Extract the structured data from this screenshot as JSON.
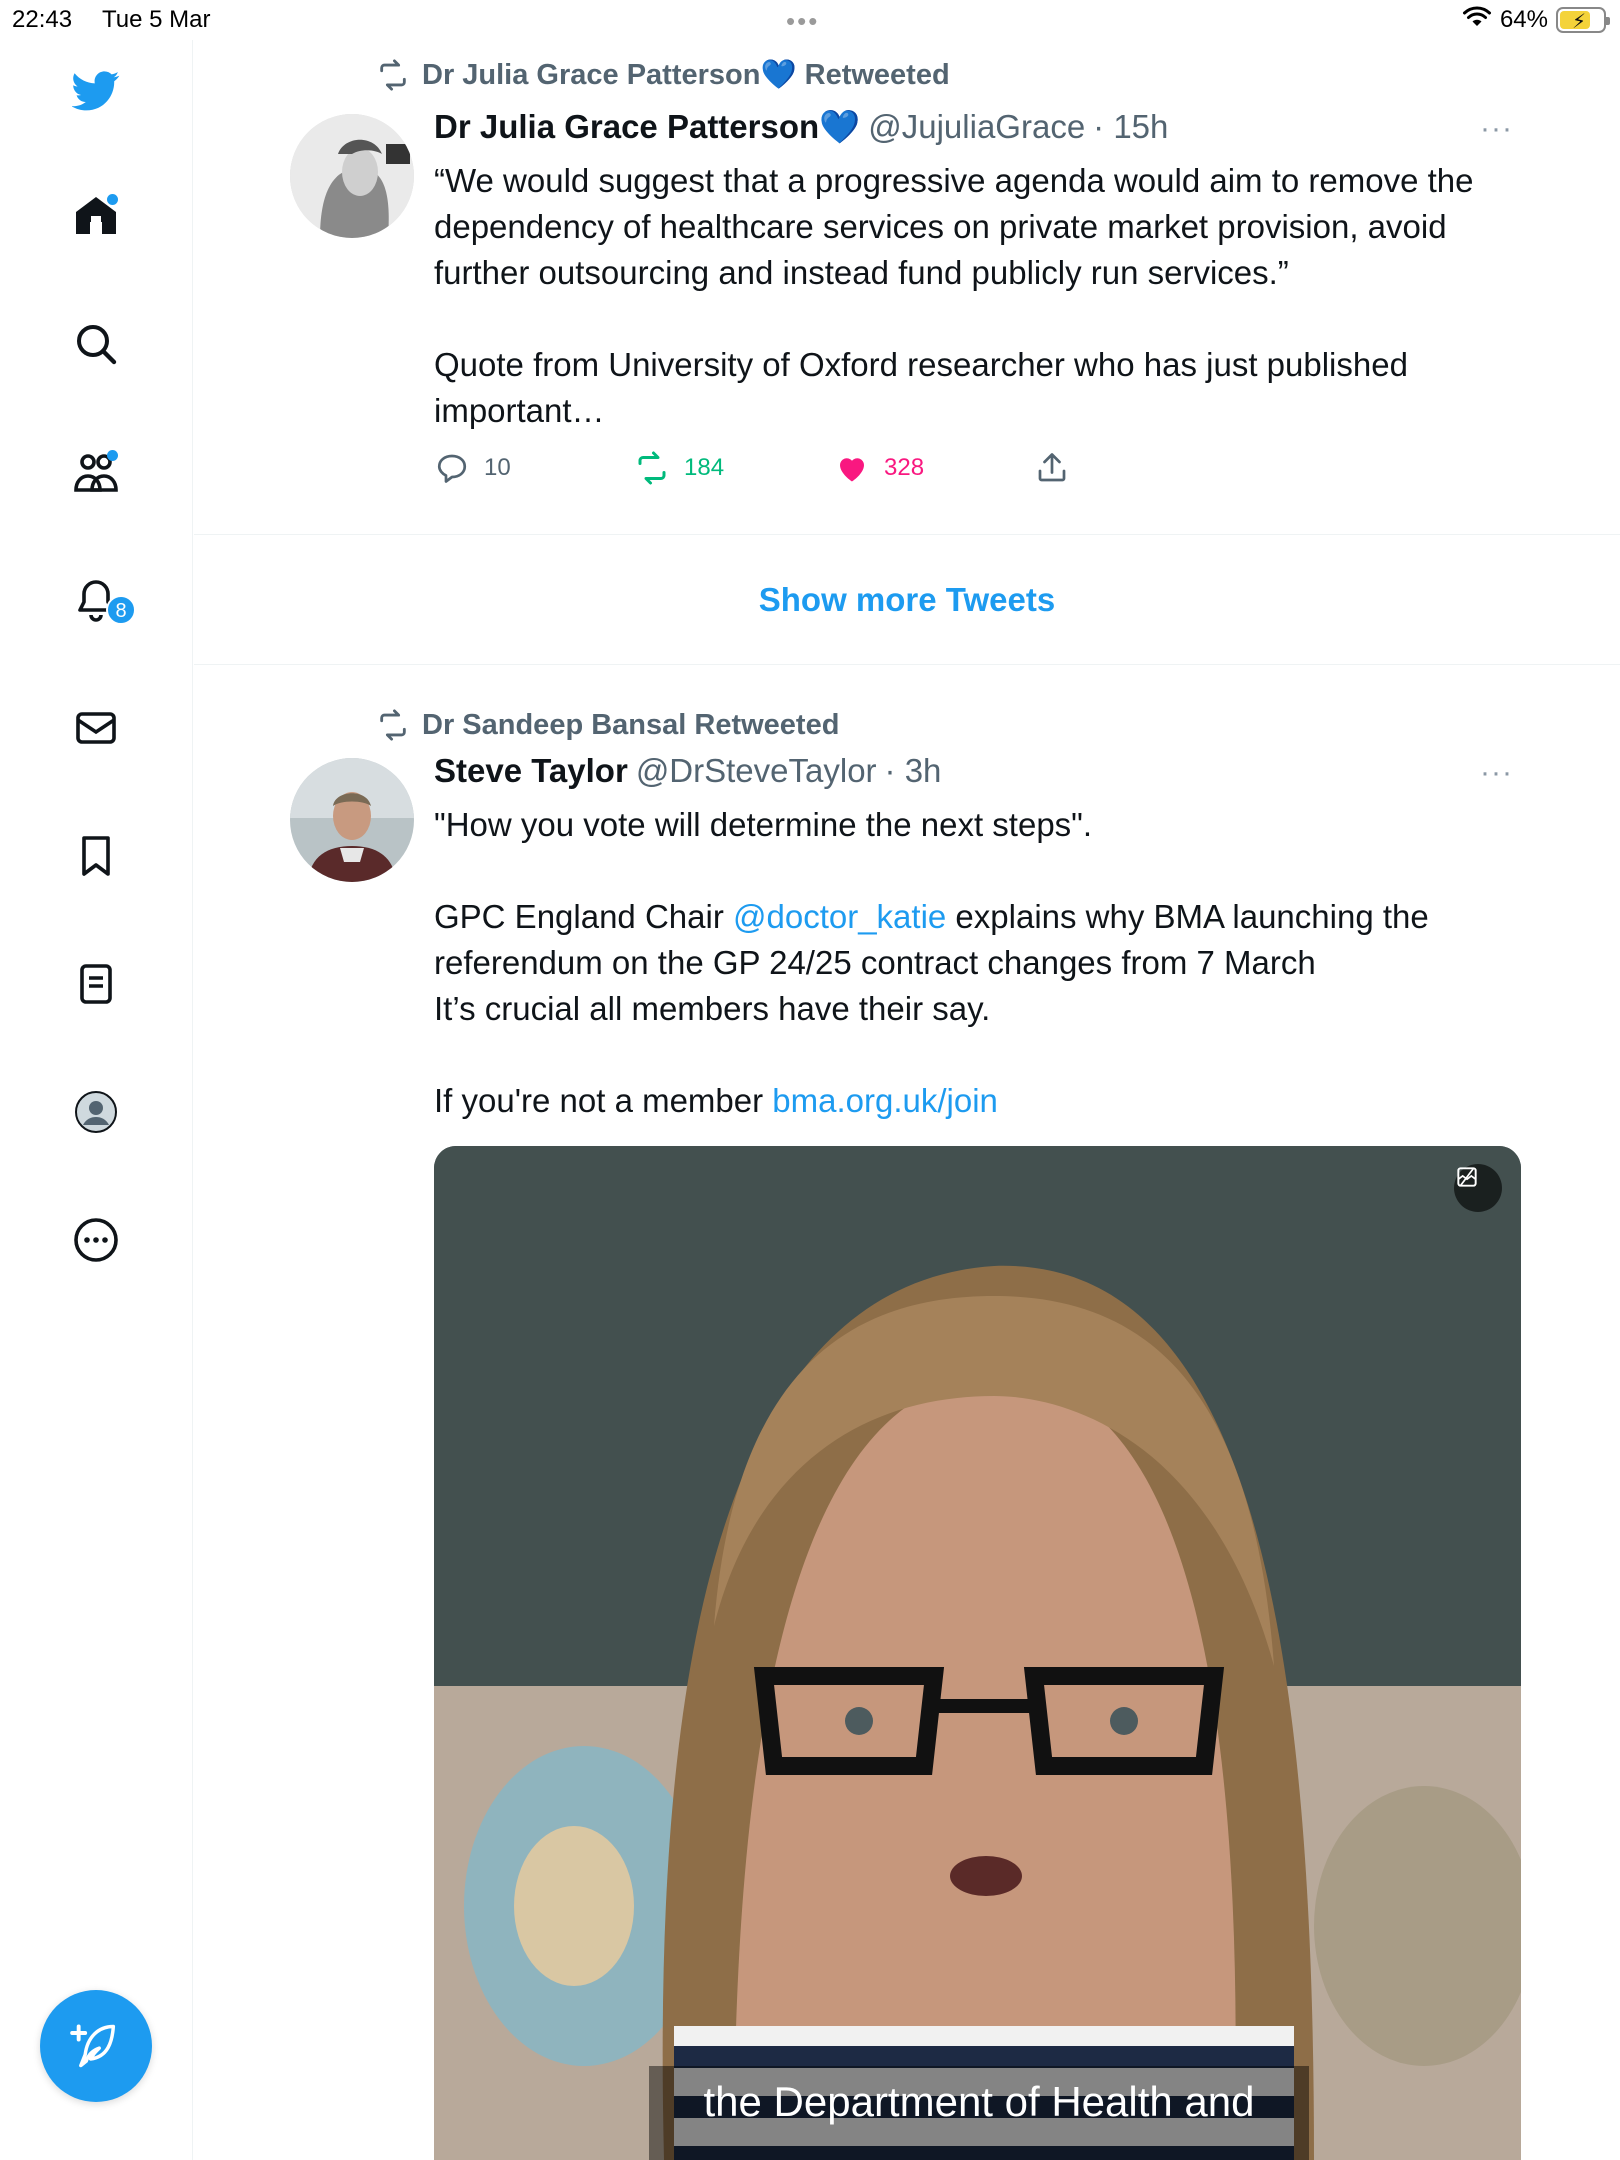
{
  "status_bar": {
    "time": "22:43",
    "date": "Tue 5 Mar",
    "battery": "64%",
    "menu_dots": "•••"
  },
  "sidebar": {
    "notifications_badge": "8",
    "items": [
      {
        "icon": "twitter-bird-icon"
      },
      {
        "icon": "home-icon",
        "has_dot": true
      },
      {
        "icon": "search-icon"
      },
      {
        "icon": "communities-icon",
        "has_dot": true
      },
      {
        "icon": "notifications-bell-icon"
      },
      {
        "icon": "messages-envelope-icon"
      },
      {
        "icon": "bookmark-icon"
      },
      {
        "icon": "lists-icon"
      },
      {
        "icon": "profile-avatar-icon"
      },
      {
        "icon": "more-circle-icon"
      }
    ],
    "compose_icon": "compose-feather-icon"
  },
  "tweets": [
    {
      "retweeted_by": "Dr Julia Grace Patterson💙 Retweeted",
      "name": "Dr Julia Grace Patterson💙",
      "handle": "@JujuliaGrace",
      "time": "· 15h",
      "more": "···",
      "lines": [
        "“We would suggest that a progressive agenda would aim to remove the",
        "dependency of healthcare services on private market provision, avoid",
        "further outsourcing and instead fund publicly run services.”",
        "",
        "Quote from University of Oxford researcher who has just published",
        "important…"
      ],
      "replies": "10",
      "retweets": "184",
      "likes": "328"
    },
    {
      "retweeted_by": "Dr Sandeep Bansal Retweeted",
      "name": "Steve Taylor",
      "handle": "@DrSteveTaylor",
      "time": "· 3h",
      "more": "···",
      "line1": "\"How you vote will determine the next steps\".",
      "line2_pre": "GPC England Chair ",
      "line2_link": "@doctor_katie",
      "line2_post": " explains why BMA launching the",
      "line3": "referendum on the GP 24/25 contract changes from 7 March",
      "line4": "It’s crucial all members have their say.",
      "line5_pre": "If you're not a member ",
      "line5_link": "bma.org.uk/join",
      "video_caption": "the Department of Health and"
    }
  ],
  "show_more": "Show more Tweets",
  "colors": {
    "accent": "#1d9bf0",
    "retweet_green": "#00ba7c",
    "like_pink": "#f91880",
    "secondary_text": "#536471"
  }
}
